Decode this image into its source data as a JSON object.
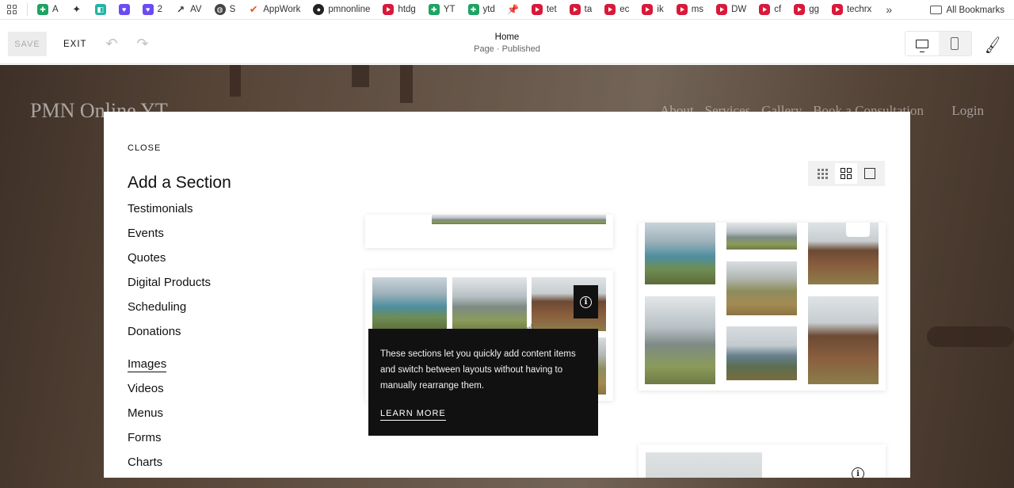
{
  "bookmarks": {
    "items": [
      {
        "label": "",
        "icon": "apps-grid-icon"
      },
      {
        "label": "A",
        "icon": "sheets-icon"
      },
      {
        "label": "",
        "icon": "puzzle-icon"
      },
      {
        "label": "",
        "icon": "teal-app-icon"
      },
      {
        "label": "",
        "icon": "chat-icon"
      },
      {
        "label": "2",
        "icon": "chat-icon"
      },
      {
        "label": "AV",
        "icon": "trend-icon"
      },
      {
        "label": "S",
        "icon": "globe-icon"
      },
      {
        "label": "AppWork",
        "icon": "check-icon"
      },
      {
        "label": "pmnonline",
        "icon": "github-icon"
      },
      {
        "label": "htdg",
        "icon": "youtube-icon"
      },
      {
        "label": "YT",
        "icon": "sheets-icon"
      },
      {
        "label": "ytd",
        "icon": "sheets-icon"
      },
      {
        "label": "",
        "icon": "pin-icon"
      },
      {
        "label": "tet",
        "icon": "youtube-icon"
      },
      {
        "label": "ta",
        "icon": "youtube-icon"
      },
      {
        "label": "ec",
        "icon": "youtube-icon"
      },
      {
        "label": "ik",
        "icon": "youtube-icon"
      },
      {
        "label": "ms",
        "icon": "youtube-icon"
      },
      {
        "label": "DW",
        "icon": "youtube-icon"
      },
      {
        "label": "cf",
        "icon": "youtube-icon"
      },
      {
        "label": "gg",
        "icon": "youtube-icon"
      },
      {
        "label": "techrx",
        "icon": "youtube-icon"
      }
    ],
    "more": "»",
    "all_bookmarks": "All Bookmarks"
  },
  "toolbar": {
    "save_label": "SAVE",
    "exit_label": "EXIT",
    "undo_glyph": "↶",
    "redo_glyph": "↷",
    "page_title": "Home",
    "page_status": "Page · Published",
    "brush_glyph": "🖌"
  },
  "site": {
    "logo": "PMN Online YT",
    "nav": [
      "About",
      "Services",
      "Gallery",
      "Book a Consultation"
    ],
    "login": "Login"
  },
  "modal": {
    "close_label": "CLOSE",
    "title": "Add a Section",
    "categories": [
      "Testimonials",
      "Events",
      "Quotes",
      "Digital Products",
      "Scheduling",
      "Donations",
      "Images",
      "Videos",
      "Menus",
      "Forms",
      "Charts"
    ],
    "active_category": "Images",
    "tooltip": {
      "text": "These sections let you quickly add content items and switch between layouts without having to manually rearrange them.",
      "learn_more": "LEARN MORE"
    },
    "info_glyph": "i"
  }
}
